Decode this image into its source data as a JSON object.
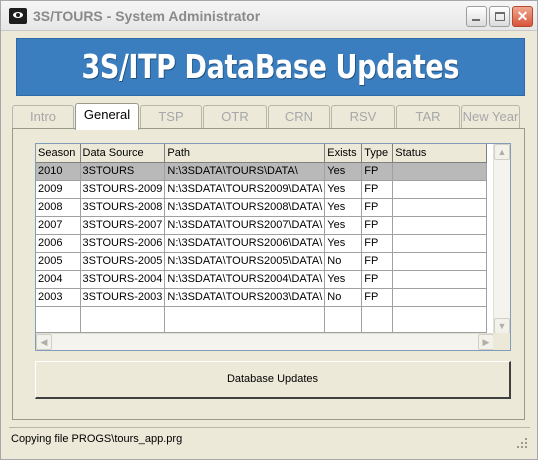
{
  "window": {
    "title": "3S/TOURS - System Administrator",
    "controls": {
      "minimize_icon": "minimize-icon",
      "maximize_icon": "maximize-icon",
      "close_icon": "close-icon"
    }
  },
  "banner": {
    "title": "3S/ITP DataBase Updates",
    "color": "#3a7ebf"
  },
  "tabs": [
    {
      "label": "Intro",
      "active": false
    },
    {
      "label": "General",
      "active": true
    },
    {
      "label": "TSP",
      "active": false
    },
    {
      "label": "OTR",
      "active": false
    },
    {
      "label": "CRN",
      "active": false
    },
    {
      "label": "RSV",
      "active": false
    },
    {
      "label": "TAR",
      "active": false
    },
    {
      "label": "New Year",
      "active": false
    }
  ],
  "grid": {
    "columns": [
      "Season",
      "Data Source",
      "Path",
      "Exists",
      "Type",
      "Status"
    ],
    "rows": [
      [
        "2010",
        "3STOURS",
        "N:\\3SDATA\\TOURS\\DATA\\",
        "Yes",
        "FP",
        ""
      ],
      [
        "2009",
        "3STOURS-2009",
        "N:\\3SDATA\\TOURS2009\\DATA\\",
        "Yes",
        "FP",
        ""
      ],
      [
        "2008",
        "3STOURS-2008",
        "N:\\3SDATA\\TOURS2008\\DATA\\",
        "Yes",
        "FP",
        ""
      ],
      [
        "2007",
        "3STOURS-2007",
        "N:\\3SDATA\\TOURS2007\\DATA\\",
        "Yes",
        "FP",
        ""
      ],
      [
        "2006",
        "3STOURS-2006",
        "N:\\3SDATA\\TOURS2006\\DATA\\",
        "Yes",
        "FP",
        ""
      ],
      [
        "2005",
        "3STOURS-2005",
        "N:\\3SDATA\\TOURS2005\\DATA\\",
        "No",
        "FP",
        ""
      ],
      [
        "2004",
        "3STOURS-2004",
        "N:\\3SDATA\\TOURS2004\\DATA\\",
        "Yes",
        "FP",
        ""
      ],
      [
        "2003",
        "3STOURS-2003",
        "N:\\3SDATA\\TOURS2003\\DATA\\",
        "No",
        "FP",
        ""
      ]
    ],
    "selected_row": 0
  },
  "actions": {
    "database_updates_label": "Database Updates"
  },
  "statusbar": {
    "message": "Copying file PROGS\\tours_app.prg"
  }
}
